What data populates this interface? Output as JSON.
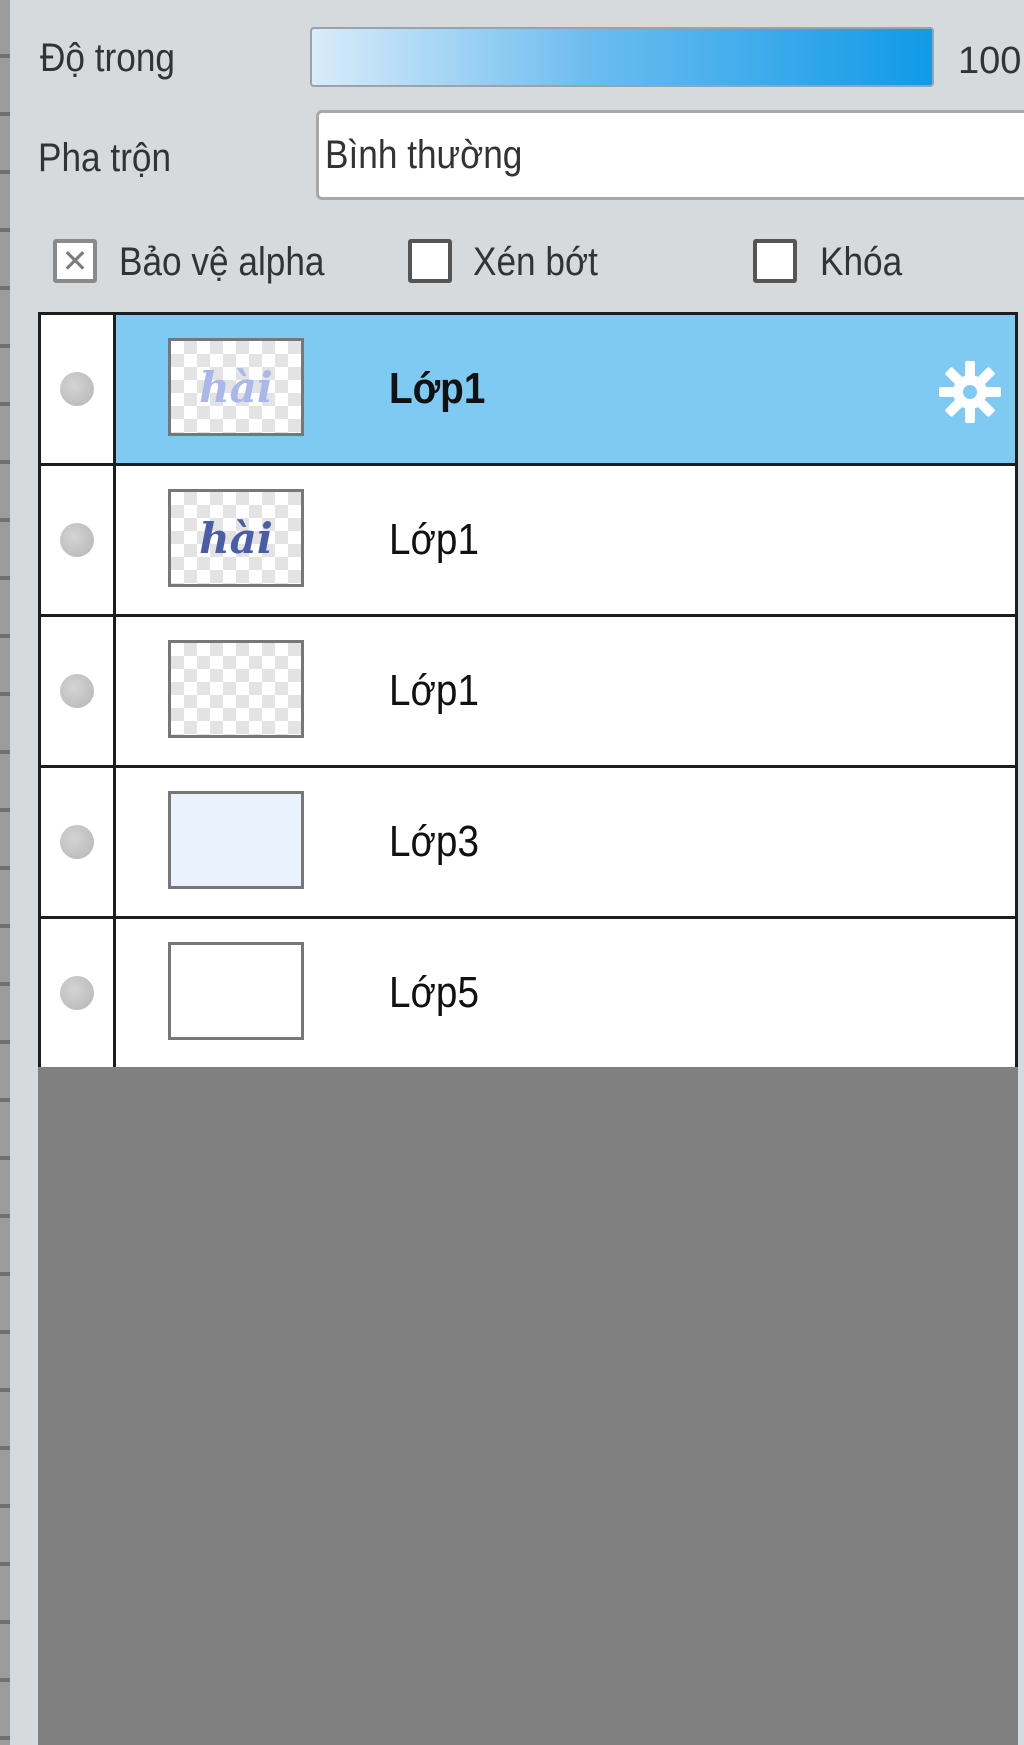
{
  "opacity": {
    "label": "Độ trong",
    "value": "100",
    "level_percent": 100
  },
  "blend": {
    "label": "Pha trộn",
    "value": "Bình thường"
  },
  "options": [
    {
      "label": "Bảo vệ alpha",
      "checked": true
    },
    {
      "label": "Xén bớt",
      "checked": false
    },
    {
      "label": "Khóa",
      "checked": false
    }
  ],
  "layers": [
    {
      "name": "Lớp1",
      "active": true,
      "thumb_text": "hài"
    },
    {
      "name": "Lớp1",
      "active": false,
      "thumb_text": "hài"
    },
    {
      "name": "Lớp1",
      "active": false
    },
    {
      "name": "Lớp3",
      "active": false
    },
    {
      "name": "Lớp5",
      "active": false
    }
  ],
  "colors": {
    "active_row": "#7fcaf3",
    "slider_end": "#109ae8",
    "empty_area": "#8a8a8a"
  }
}
